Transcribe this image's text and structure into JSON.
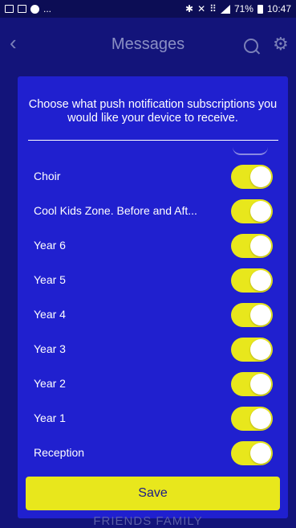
{
  "status_bar": {
    "overflow": "...",
    "battery": "71%",
    "time": "10:47"
  },
  "nav": {
    "title": "Messages",
    "back_icon": "chevron-left-icon",
    "search_icon": "search-icon",
    "settings_icon": "gear-icon"
  },
  "panel": {
    "instructions": "Choose what push notification subscriptions you would like your device to receive.",
    "items": [
      {
        "label": "Choir",
        "enabled": true
      },
      {
        "label": "Cool Kids Zone. Before and Aft...",
        "enabled": true
      },
      {
        "label": "Year 6",
        "enabled": true
      },
      {
        "label": "Year 5",
        "enabled": true
      },
      {
        "label": "Year 4",
        "enabled": true
      },
      {
        "label": "Year 3",
        "enabled": true
      },
      {
        "label": "Year 2",
        "enabled": true
      },
      {
        "label": "Year 1",
        "enabled": true
      },
      {
        "label": "Reception",
        "enabled": true
      }
    ]
  },
  "save_label": "Save",
  "footer_text": "FRIENDS FAMILY",
  "colors": {
    "background": "#13147a",
    "panel": "#2020cf",
    "accent": "#e8e71c",
    "text": "#ffffff"
  }
}
